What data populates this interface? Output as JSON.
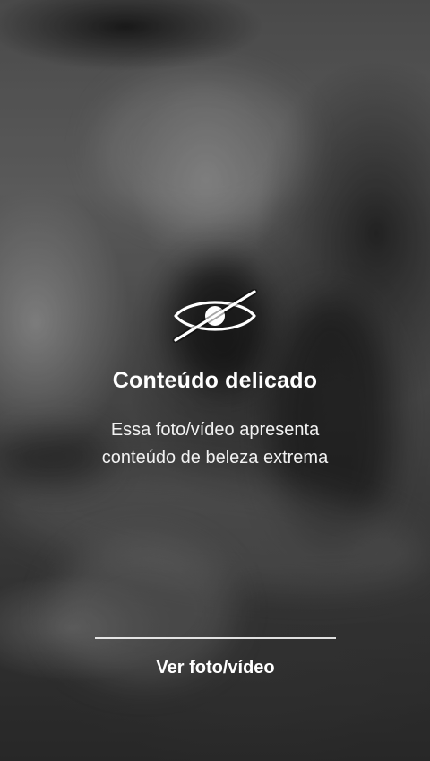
{
  "overlay": {
    "icon": "eye-slash-icon",
    "title": "Conteúdo delicado",
    "description_line1": "Essa foto/vídeo apresenta",
    "description_line2": "conteúdo de beleza extrema",
    "action_label": "Ver foto/vídeo"
  },
  "colors": {
    "text": "#ffffff",
    "divider": "#ffffff"
  }
}
